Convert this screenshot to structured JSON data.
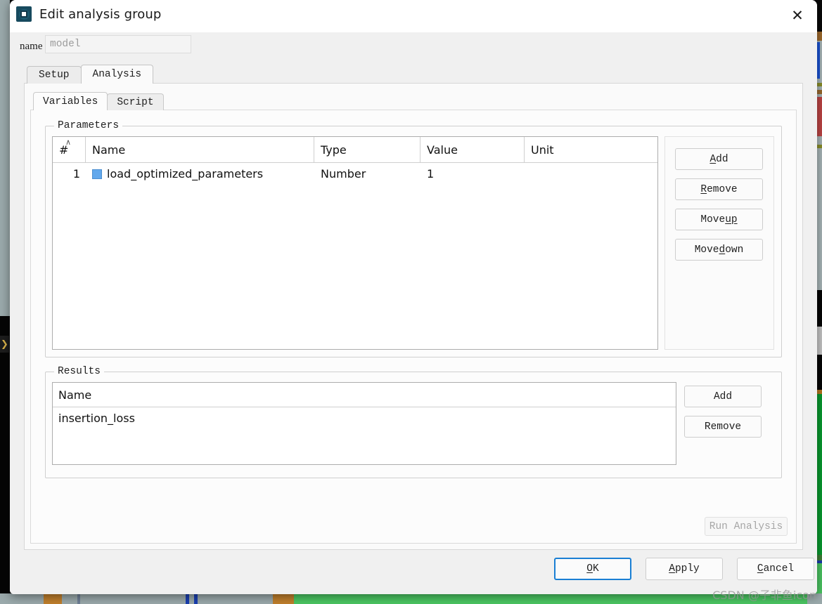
{
  "window": {
    "title": "Edit analysis group",
    "app_icon": "lumerical-app-icon",
    "close_icon": "close-icon"
  },
  "name_field": {
    "label": "name",
    "value": "model",
    "placeholder": "model"
  },
  "outer_tabs": [
    {
      "label": "Setup",
      "active": false
    },
    {
      "label": "Analysis",
      "active": true
    }
  ],
  "inner_tabs": [
    {
      "label": "Variables",
      "active": true
    },
    {
      "label": "Script",
      "active": false
    }
  ],
  "parameters": {
    "group_title": "Parameters",
    "sort_caret": "∧",
    "columns": [
      "#",
      "Name",
      "Type",
      "Value",
      "Unit"
    ],
    "rows": [
      {
        "index": "1",
        "name": "load_optimized_parameters",
        "type": "Number",
        "value": "1",
        "unit": "",
        "swatch_color": "#62a8ec"
      }
    ],
    "buttons": [
      {
        "id": "add",
        "mnemonic": "A",
        "rest": "dd",
        "pre": "",
        "label": "Add"
      },
      {
        "id": "remove",
        "mnemonic": "R",
        "rest": "emove",
        "pre": "",
        "label": "Remove"
      },
      {
        "id": "move-up",
        "mnemonic": "up",
        "rest": "",
        "pre": "Move ",
        "label": "Move up"
      },
      {
        "id": "move-down",
        "mnemonic": "d",
        "rest": "own",
        "pre": "Move ",
        "label": "Move down"
      }
    ]
  },
  "results": {
    "group_title": "Results",
    "column": "Name",
    "rows": [
      "insertion_loss"
    ],
    "buttons": [
      {
        "id": "add",
        "label": "Add"
      },
      {
        "id": "remove",
        "label": "Remove"
      }
    ]
  },
  "run_analysis": {
    "label": "Run Analysis",
    "enabled": false
  },
  "footer_buttons": [
    {
      "id": "ok",
      "pre": "",
      "mnemonic": "O",
      "rest": "K",
      "label": "OK",
      "default": true
    },
    {
      "id": "apply",
      "pre": "",
      "mnemonic": "A",
      "rest": "pply",
      "label": "Apply",
      "default": false
    },
    {
      "id": "cancel",
      "pre": "",
      "mnemonic": "C",
      "rest": "ancel",
      "label": "Cancel",
      "default": false
    }
  ],
  "watermark": "CSDN @子非鱼icon",
  "colors": {
    "accent": "#1a7fd4",
    "titlebar": "#ffffff",
    "dialog_bg": "#f0f0f0",
    "panel_bg": "#fcfcfc",
    "swatch": "#62a8ec",
    "disabled_text": "#a6a6a6"
  }
}
